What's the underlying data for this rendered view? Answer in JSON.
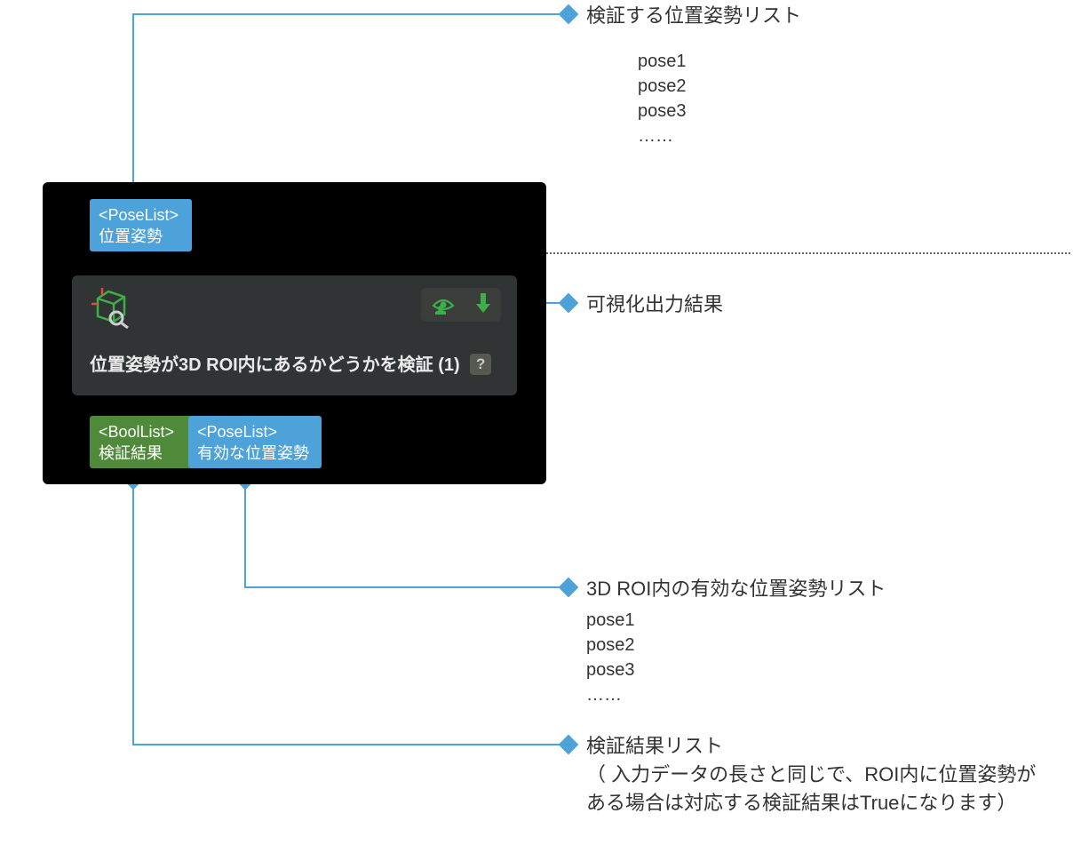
{
  "node": {
    "input_port": {
      "type": "<PoseList>",
      "label": "位置姿勢"
    },
    "title": "位置姿勢が3D ROI内にあるかどうかを検証 (1)",
    "help": "?",
    "output_port_1": {
      "type": "<BoolList>",
      "label": "検証結果"
    },
    "output_port_2": {
      "type": "<PoseList>",
      "label": "有効な位置姿勢"
    }
  },
  "annotations": {
    "input_list": {
      "title": "検証する位置姿勢リスト",
      "items": "pose1\npose2\npose3\n……"
    },
    "viz_output": "可視化出力結果",
    "valid_list": {
      "title": "3D  ROI内の有効な位置姿勢リスト",
      "items": "pose1\npose2\npose3\n……"
    },
    "result_list": "検証結果リスト\n（ 入力データの長さと同じで、ROI内に位置姿勢がある場合は対応する検証結果はTrueになります）"
  },
  "colors": {
    "leader": "#4ca2d9",
    "port_blue": "#4ca2d9",
    "port_green": "#4e8a3a",
    "action_green": "#3fae49"
  }
}
